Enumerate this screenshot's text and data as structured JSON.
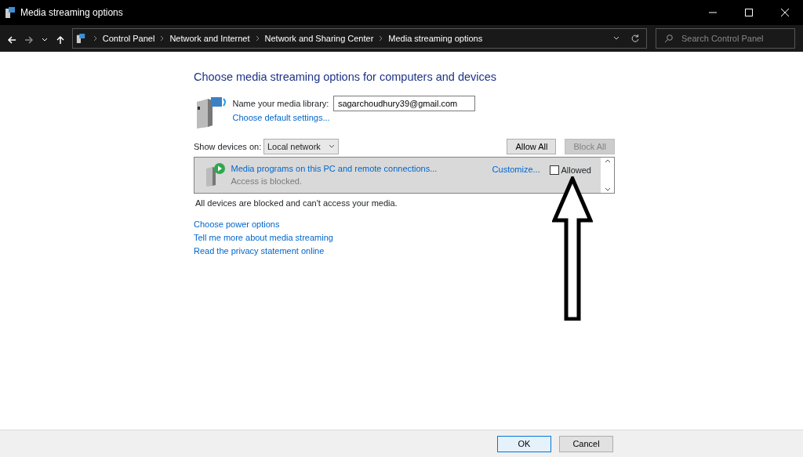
{
  "window": {
    "title": "Media streaming options"
  },
  "breadcrumbs": [
    "Control Panel",
    "Network and Internet",
    "Network and Sharing Center",
    "Media streaming options"
  ],
  "search": {
    "placeholder": "Search Control Panel"
  },
  "heading": "Choose media streaming options for computers and devices",
  "library": {
    "label": "Name your media library:",
    "value": "sagarchoudhury39@gmail.com",
    "link": "Choose default settings..."
  },
  "show_devices": {
    "label": "Show devices on:",
    "value": "Local network"
  },
  "toolbar_buttons": [
    {
      "label": "Allow All",
      "disabled": false
    },
    {
      "label": "Block All",
      "disabled": true
    }
  ],
  "devices": [
    {
      "name": "Media programs on this PC and remote connections...",
      "status": "Access is blocked.",
      "customize": "Customize...",
      "allowed_label": "Allowed",
      "checked": false
    }
  ],
  "notice": "All devices are blocked and can't access your media.",
  "links": [
    "Choose power options",
    "Tell me more about media streaming",
    "Read the privacy statement online"
  ],
  "footer_buttons": [
    {
      "label": "OK",
      "default": true
    },
    {
      "label": "Cancel",
      "default": false
    }
  ]
}
